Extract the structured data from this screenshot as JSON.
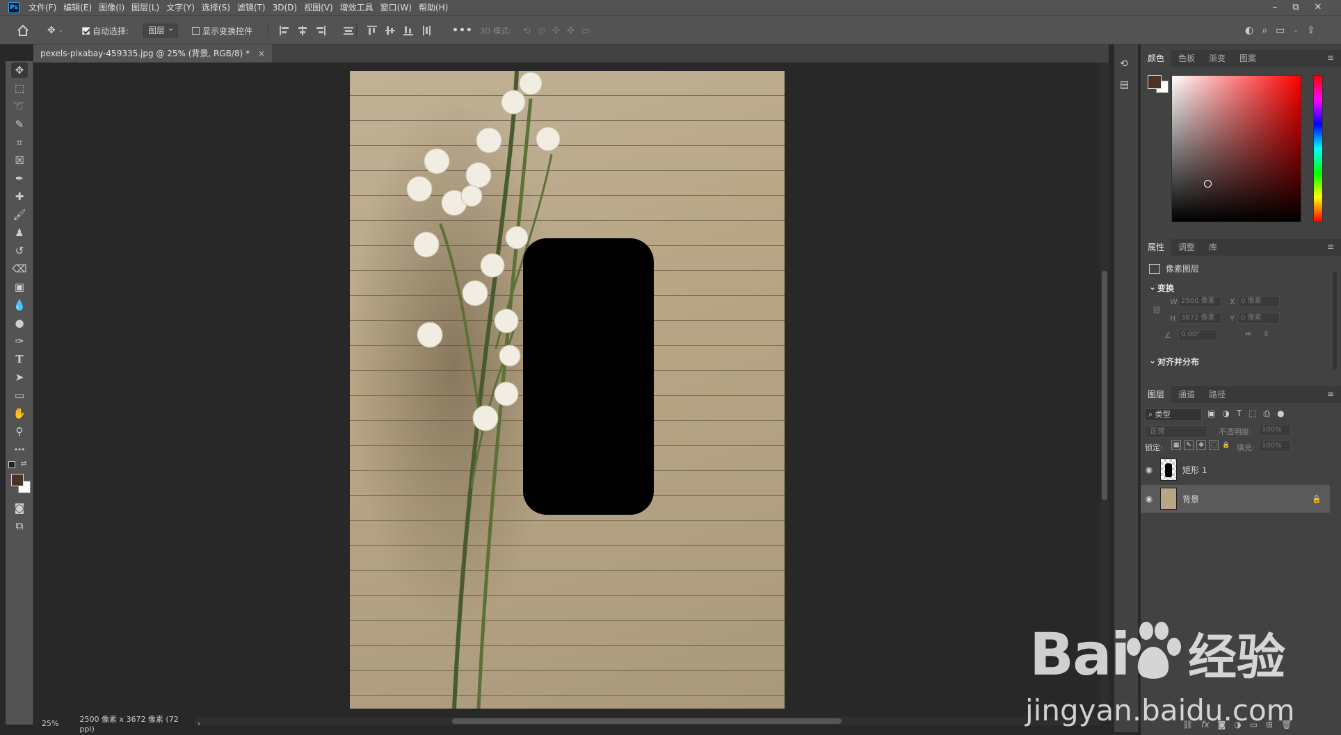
{
  "app": {
    "logo": "Ps"
  },
  "menubar": {
    "items": [
      "文件(F)",
      "编辑(E)",
      "图像(I)",
      "图层(L)",
      "文字(Y)",
      "选择(S)",
      "滤镜(T)",
      "3D(D)",
      "视图(V)",
      "增效工具",
      "窗口(W)",
      "帮助(H)"
    ],
    "window_controls": {
      "minimize": "–",
      "restore": "⧉",
      "close": "✕"
    }
  },
  "options_bar": {
    "home_icon": "home-icon",
    "auto_select_label": "自动选择:",
    "auto_select_checked": true,
    "auto_select_target": "图层",
    "show_transform_label": "显示变换控件",
    "show_transform_checked": false,
    "more": "•••",
    "mode_3d_label": "3D 模式:"
  },
  "document": {
    "tab_title": "pexels-pixabay-459335.jpg @ 25% (背景, RGB/8) *",
    "tab_close": "×"
  },
  "status": {
    "zoom": "25%",
    "dimensions": "2500 像素 x 3672 像素 (72 ppi)",
    "arrow": "›"
  },
  "color_panel": {
    "tabs": [
      "颜色",
      "色板",
      "渐变",
      "图案"
    ],
    "active_tab": "颜色",
    "foreground": "#4b3226",
    "background": "#ffffff",
    "hue": "#ff0000"
  },
  "properties_panel": {
    "tabs": [
      "属性",
      "调整",
      "库"
    ],
    "active_tab": "属性",
    "layer_type": "像素图层",
    "transform_title": "变换",
    "w_label": "W",
    "w_value": "2500 像素",
    "x_label": "X",
    "x_value": "0 像素",
    "h_label": "H",
    "h_value": "3672 像素",
    "y_label": "Y",
    "y_value": "0 像素",
    "angle_value": "0.00°",
    "align_title": "对齐并分布"
  },
  "layers_panel": {
    "tabs": [
      "图层",
      "通道",
      "路径"
    ],
    "active_tab": "图层",
    "filter_kind": "类型",
    "blend_mode": "正常",
    "opacity_label": "不透明度:",
    "opacity_value": "100%",
    "lock_label": "锁定:",
    "fill_label": "填充:",
    "fill_value": "100%",
    "layers": [
      {
        "name": "矩形 1",
        "visible": true,
        "selected": false,
        "locked": false
      },
      {
        "name": "背景",
        "visible": true,
        "selected": true,
        "locked": true
      }
    ],
    "footer_icons": [
      "link-icon",
      "fx-icon",
      "mask-icon",
      "adjustment-icon",
      "folder-icon",
      "new-layer-icon",
      "trash-icon"
    ],
    "footer_fx": "fx"
  },
  "watermark": {
    "brand": "Bai",
    "brand_cn": "经验",
    "url": "jingyan.baidu.com"
  }
}
